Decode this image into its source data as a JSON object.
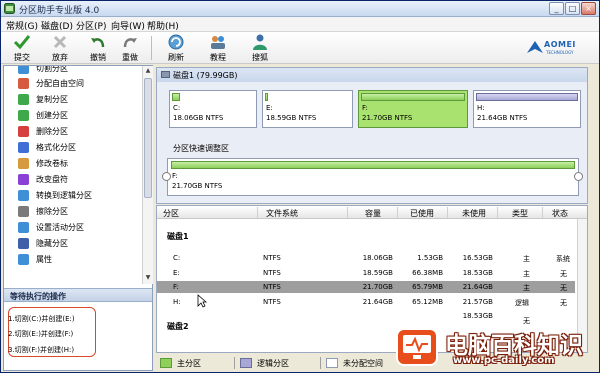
{
  "window": {
    "title": "分区助手专业版 4.0",
    "controls": {
      "minimize": "_",
      "maximize": "□",
      "close": "×"
    }
  },
  "menu": [
    "常规(G)",
    "磁盘(D)",
    "分区(P)",
    "向导(W)",
    "帮助(H)"
  ],
  "toolbar": {
    "buttons": [
      {
        "label": "提交",
        "icon": "check-icon"
      },
      {
        "label": "放弃",
        "icon": "discard-icon"
      },
      {
        "label": "撤销",
        "icon": "undo-icon"
      },
      {
        "label": "重做",
        "icon": "redo-icon"
      },
      {
        "label": "刷新",
        "icon": "refresh-icon"
      },
      {
        "label": "教程",
        "icon": "tutorial-icon"
      },
      {
        "label": "搜狐",
        "icon": "people-icon"
      }
    ],
    "brand": {
      "name": "AOMEI",
      "tagline": "TECHNOLOGY"
    }
  },
  "operations": {
    "items": [
      {
        "label": "切割分区",
        "color": "#3F8FD6"
      },
      {
        "label": "分配自由空间",
        "color": "#D65A3F"
      },
      {
        "label": "复制分区",
        "color": "#3FA84A"
      },
      {
        "label": "创建分区",
        "color": "#3FA84A"
      },
      {
        "label": "删除分区",
        "color": "#D63F3F"
      },
      {
        "label": "格式化分区",
        "color": "#3F6FD6"
      },
      {
        "label": "修改卷标",
        "color": "#D69A3F"
      },
      {
        "label": "改变盘符",
        "color": "#8A3FD6"
      },
      {
        "label": "转换到逻辑分区",
        "color": "#3F8FD6"
      },
      {
        "label": "擦除分区",
        "color": "#7A7A7A"
      },
      {
        "label": "设置活动分区",
        "color": "#3F8FD6"
      },
      {
        "label": "隐藏分区",
        "color": "#3F5FA8"
      },
      {
        "label": "属性",
        "color": "#3F8FD6"
      }
    ],
    "pending_title": "等待执行的操作",
    "pending": [
      "1.切割(C:)并创建(E:)",
      "2.切割(E:)并创建(F:)",
      "3.切割(F:)并创建(H:)"
    ]
  },
  "disk_map": {
    "disk_label": "磁盘1 (79.99GB)",
    "partitions": [
      {
        "name": "C:",
        "detail": "18.06GB NTFS",
        "used_fraction": 0.08,
        "type": "primary"
      },
      {
        "name": "E:",
        "detail": "18.59GB NTFS",
        "used_fraction": 0.02,
        "type": "primary"
      },
      {
        "name": "F:",
        "detail": "21.70GB NTFS",
        "used_fraction": 1.0,
        "type": "primary",
        "selected": true
      },
      {
        "name": "H:",
        "detail": "21.64GB NTFS",
        "used_fraction": 1.0,
        "type": "logical"
      }
    ],
    "resize_title": "分区快速调整区",
    "resize_partition": {
      "name": "F:",
      "detail": "21.70GB NTFS"
    }
  },
  "table": {
    "columns": [
      "分区",
      "文件系统",
      "容量",
      "已使用",
      "未使用",
      "类型",
      "状态"
    ],
    "groups": [
      {
        "name": "磁盘1",
        "rows": [
          {
            "partition": "C:",
            "fs": "NTFS",
            "capacity": "18.06GB",
            "used": "1.53GB",
            "free": "16.53GB",
            "type": "主",
            "status": "系统",
            "selected": false
          },
          {
            "partition": "E:",
            "fs": "NTFS",
            "capacity": "18.59GB",
            "used": "66.38MB",
            "free": "18.53GB",
            "type": "主",
            "status": "无",
            "selected": false
          },
          {
            "partition": "F:",
            "fs": "NTFS",
            "capacity": "21.70GB",
            "used": "65.79MB",
            "free": "21.64GB",
            "type": "主",
            "status": "无",
            "selected": true
          },
          {
            "partition": "H:",
            "fs": "NTFS",
            "capacity": "21.64GB",
            "used": "65.12MB",
            "free": "21.57GB",
            "type": "逻辑",
            "status": "无",
            "selected": false
          }
        ]
      },
      {
        "name": "磁盘2",
        "rows": [
          {
            "partition": "",
            "fs": "",
            "capacity": "",
            "used": "",
            "free": "18.53GB",
            "type": "无",
            "status": "",
            "selected": false
          }
        ]
      }
    ]
  },
  "legend": [
    {
      "label": "主分区",
      "color": "#8ED05A"
    },
    {
      "label": "逻辑分区",
      "color": "#A8A8D8"
    },
    {
      "label": "未分配空间",
      "color": "#FFFFFF"
    }
  ],
  "watermark": {
    "text": "电脑百科知识",
    "url": "www.pc-daily.com"
  }
}
